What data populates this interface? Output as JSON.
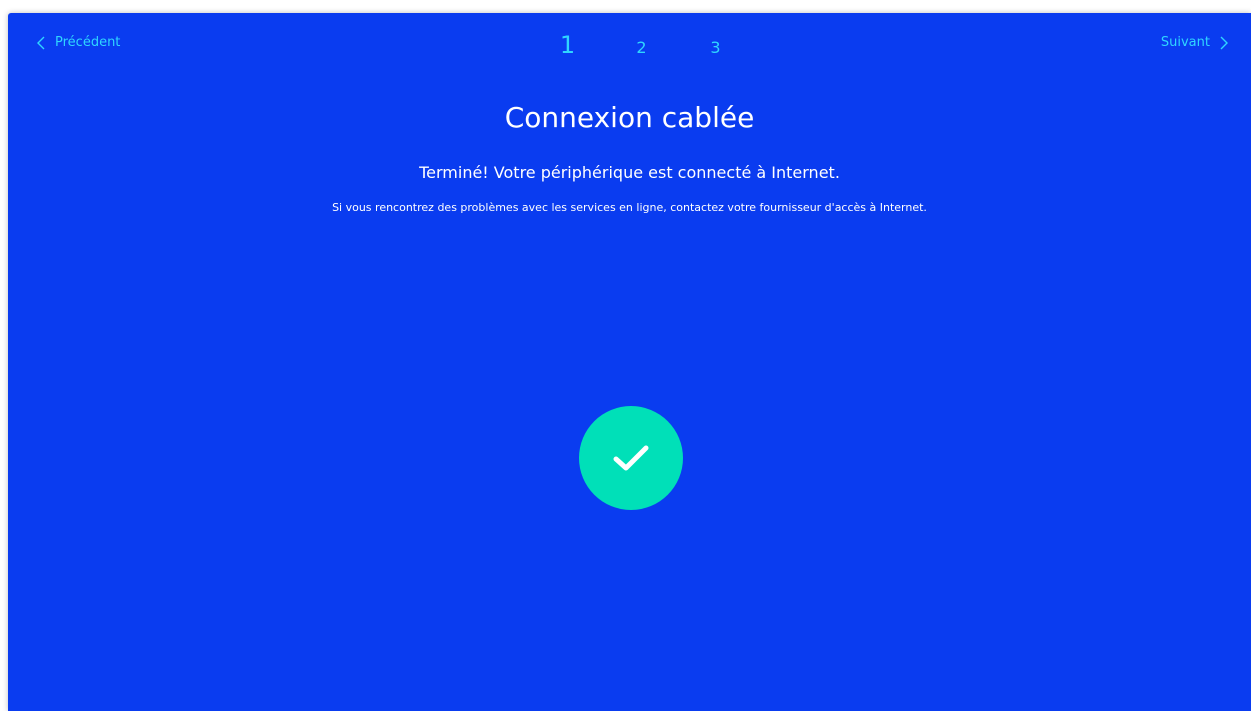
{
  "nav": {
    "prev_label": "Précédent",
    "next_label": "Suivant",
    "prev_icon": "chevron-left-icon",
    "next_icon": "chevron-right-icon"
  },
  "steps": [
    "1",
    "2",
    "3"
  ],
  "active_step": "1",
  "title": "Connexion cablée",
  "subtitle": "Terminé! Votre périphérique est connecté à Internet.",
  "note": "Si vous rencontrez des problèmes avec les services en ligne, contactez votre fournisseur d'accès à Internet.",
  "status_icon": "checkmark-icon",
  "colors": {
    "background": "#0a3cf0",
    "accent": "#2fd6ff",
    "success": "#00e0b8",
    "text": "#ffffff"
  }
}
